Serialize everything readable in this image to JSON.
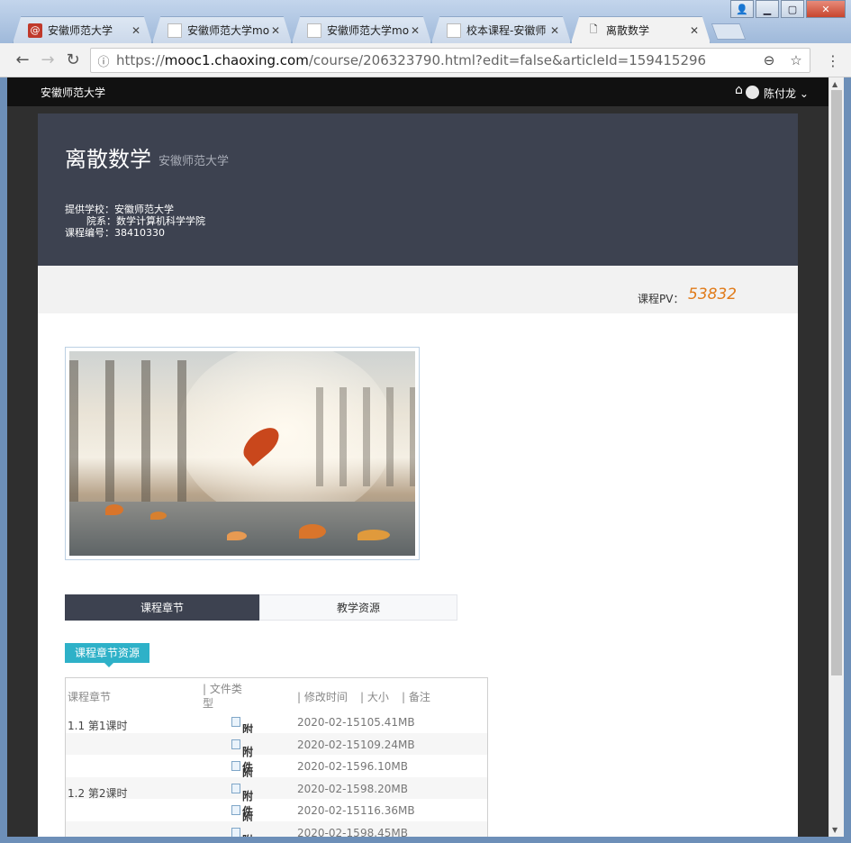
{
  "browser": {
    "tabs": [
      {
        "label": "安徽师范大学",
        "favicon": "at-sign-icon"
      },
      {
        "label": "安徽师范大学moo",
        "favicon": "page-icon"
      },
      {
        "label": "安徽师范大学moo",
        "favicon": "page-icon"
      },
      {
        "label": "校本课程-安徽师",
        "favicon": "page-icon"
      },
      {
        "label": "离散数学",
        "favicon": "page-icon"
      }
    ],
    "active_tab": 4,
    "url_scheme": "https://",
    "url_host": "mooc1.chaoxing.com",
    "url_path": "/course/206323790.html?edit=false&articleId=159415296"
  },
  "topnav": {
    "school": "安徽师范大学",
    "user": "陈付龙"
  },
  "course": {
    "title": "离散数学",
    "school_subtitle": "安徽师范大学",
    "provider_label": "提供学校：",
    "provider": "安徽师范大学",
    "dept_label": "院系：",
    "dept": "数学计算机科学学院",
    "code_label": "课程编号：",
    "code": "38410330",
    "pv_label": "课程PV：",
    "pv": "53832"
  },
  "content_tabs": [
    "课程章节",
    "教学资源"
  ],
  "active_content_tab": 0,
  "resource_badge": "课程章节资源",
  "table": {
    "headers": {
      "chapter": "课程章节",
      "filetype_1": "| 文件类",
      "filetype_2": "型",
      "modified": "| 修改时间",
      "size": "| 大小",
      "note": "| 备注"
    },
    "rows": [
      {
        "chapter": "1.1 第1课时",
        "type": "附件",
        "date": "2020-02-15",
        "size": "105.41MB"
      },
      {
        "chapter": "",
        "type": "附件",
        "date": "2020-02-15",
        "size": "109.24MB"
      },
      {
        "chapter": "",
        "type": "附件",
        "date": "2020-02-15",
        "size": "96.10MB"
      },
      {
        "chapter": "1.2 第2课时",
        "type": "附件",
        "date": "2020-02-15",
        "size": "98.20MB"
      },
      {
        "chapter": "",
        "type": "附件",
        "date": "2020-02-15",
        "size": "116.36MB"
      },
      {
        "chapter": "",
        "type": "附件",
        "date": "2020-02-15",
        "size": "98.45MB"
      }
    ]
  },
  "colors": {
    "banner": "#3d4250",
    "badge": "#2eb1c8",
    "pv": "#e07b1a"
  }
}
